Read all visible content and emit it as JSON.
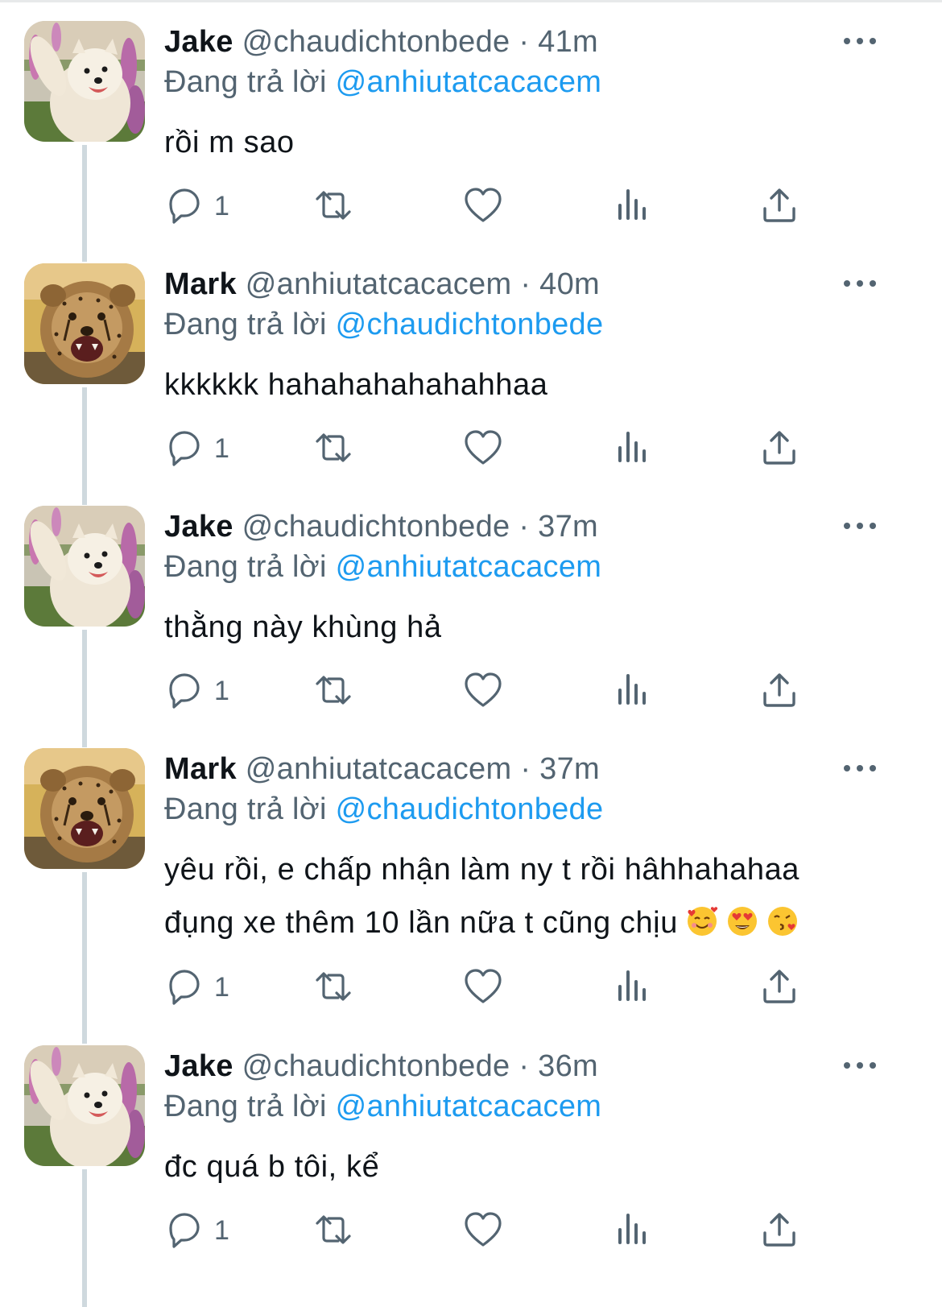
{
  "tweets": [
    {
      "name": "Jake",
      "handle": "@chaudichtonbede",
      "separator": "·",
      "time": "41m",
      "replying_prefix": "Đang trả lời",
      "replying_to": "@anhiutatcacacem",
      "lines": [
        "rồi m sao"
      ],
      "reply_count": "1",
      "avatar": "samoyed-dog"
    },
    {
      "name": "Mark",
      "handle": "@anhiutatcacacem",
      "separator": "·",
      "time": "40m",
      "replying_prefix": "Đang trả lời",
      "replying_to": "@chaudichtonbede",
      "lines": [
        "kkkkkk hahahahahahahhaa"
      ],
      "reply_count": "1",
      "avatar": "cheetah-cub"
    },
    {
      "name": "Jake",
      "handle": "@chaudichtonbede",
      "separator": "·",
      "time": "37m",
      "replying_prefix": "Đang trả lời",
      "replying_to": "@anhiutatcacacem",
      "lines": [
        "thằng này khùng hả"
      ],
      "reply_count": "1",
      "avatar": "samoyed-dog"
    },
    {
      "name": "Mark",
      "handle": "@anhiutatcacacem",
      "separator": "·",
      "time": "37m",
      "replying_prefix": "Đang trả lời",
      "replying_to": "@chaudichtonbede",
      "lines": [
        "yêu rồi, e chấp nhận làm ny t rồi hâhhahahaa",
        "đụng xe thêm 10 lần nữa t cũng chịu"
      ],
      "emojis": [
        "smiling-face-with-hearts",
        "heart-eyes",
        "face-blowing-kiss"
      ],
      "reply_count": "1",
      "avatar": "cheetah-cub"
    },
    {
      "name": "Jake",
      "handle": "@chaudichtonbede",
      "separator": "·",
      "time": "36m",
      "replying_prefix": "Đang trả lời",
      "replying_to": "@anhiutatcacacem",
      "lines": [
        "đc quá b tôi, kể"
      ],
      "reply_count": "1",
      "avatar": "samoyed-dog"
    }
  ],
  "icons": {
    "more": "more-horizontal-icon",
    "reply": "reply-bubble-icon",
    "retweet": "retweet-icon",
    "like": "heart-icon",
    "views": "views-bar-chart-icon",
    "share": "share-upload-icon"
  },
  "colors": {
    "text": "#0f1419",
    "secondary": "#536471",
    "link": "#1d9bf0",
    "thread_line": "#cfd9de"
  }
}
